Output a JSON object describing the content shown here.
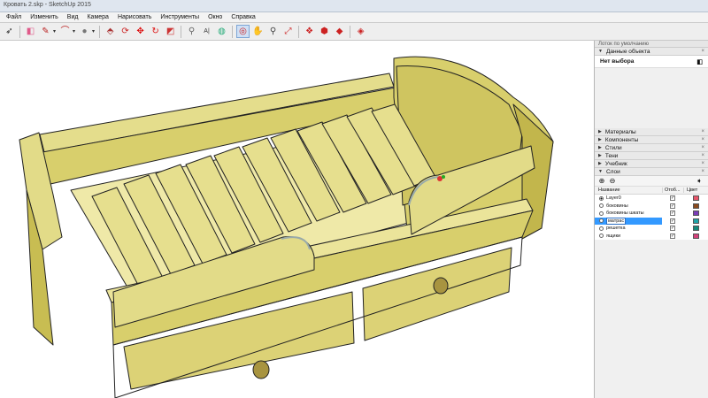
{
  "window": {
    "title": "Кровать 2.skp - SketchUp 2015"
  },
  "menu": [
    "Файл",
    "Изменить",
    "Вид",
    "Камера",
    "Нарисовать",
    "Инструменты",
    "Окно",
    "Справка"
  ],
  "tray": {
    "title": "Лоток по умолчанию",
    "entity_info": {
      "title": "Данные объекта",
      "value": "Нет выбора",
      "close": "×"
    },
    "panels": [
      "Материалы",
      "Компоненты",
      "Стили",
      "Тени",
      "Учебник",
      "Слои"
    ],
    "layers": {
      "columns": {
        "name": "Название",
        "visible": "Отоб...",
        "color": "Цвет"
      },
      "rows": [
        {
          "name": "Layer0",
          "active": true,
          "visible": true,
          "color": "#e8556a"
        },
        {
          "name": "боковины",
          "active": false,
          "visible": true,
          "color": "#8b4a1c"
        },
        {
          "name": "боковины шкаты",
          "active": false,
          "visible": true,
          "color": "#7a3db8"
        },
        {
          "name": "матрас",
          "active": false,
          "visible": true,
          "color": "#1fa3a8"
        },
        {
          "name": "решетка",
          "active": false,
          "visible": true,
          "color": "#13887a"
        },
        {
          "name": "ящики",
          "active": false,
          "visible": true,
          "color": "#d4407a"
        }
      ],
      "selected_index": 3
    }
  }
}
